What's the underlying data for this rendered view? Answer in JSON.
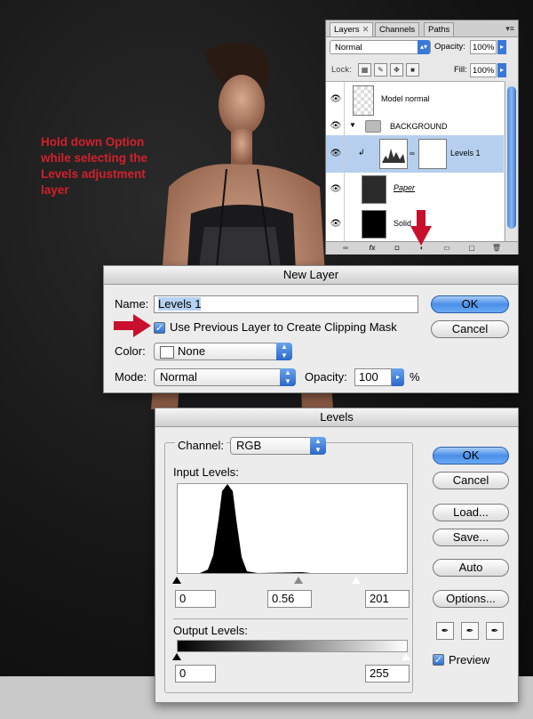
{
  "annotation": {
    "lines": [
      "Hold down Option",
      "while selecting the",
      "Levels adjustment",
      "layer"
    ]
  },
  "layers_panel": {
    "tabs": [
      "Layers",
      "Channels",
      "Paths"
    ],
    "blend_mode": "Normal",
    "opacity_label": "Opacity:",
    "opacity": "100%",
    "lock_label": "Lock:",
    "fill_label": "Fill:",
    "fill": "100%",
    "layers": [
      {
        "name": "Model normal"
      },
      {
        "name": "BACKGROUND"
      },
      {
        "name": "Levels 1"
      },
      {
        "name": "Paper"
      },
      {
        "name": "Solid"
      }
    ]
  },
  "new_layer": {
    "title": "New Layer",
    "name_label": "Name:",
    "name_value": "Levels 1",
    "clip_label": "Use Previous Layer to Create Clipping Mask",
    "clip_checked": true,
    "color_label": "Color:",
    "color_value": "None",
    "mode_label": "Mode:",
    "mode_value": "Normal",
    "opacity_label": "Opacity:",
    "opacity_value": "100",
    "percent": "%",
    "ok": "OK",
    "cancel": "Cancel"
  },
  "levels": {
    "title": "Levels",
    "channel_label": "Channel:",
    "channel_value": "RGB",
    "input_label": "Input Levels:",
    "input_black": "0",
    "input_gamma": "0.56",
    "input_white": "201",
    "output_label": "Output Levels:",
    "output_black": "0",
    "output_white": "255",
    "buttons": {
      "ok": "OK",
      "cancel": "Cancel",
      "load": "Load...",
      "save": "Save...",
      "auto": "Auto",
      "options": "Options..."
    },
    "preview_label": "Preview",
    "preview_checked": true
  },
  "colors": {
    "annotation": "#d2202c",
    "accent": "#3a78d8",
    "arrow": "#c8102e"
  }
}
